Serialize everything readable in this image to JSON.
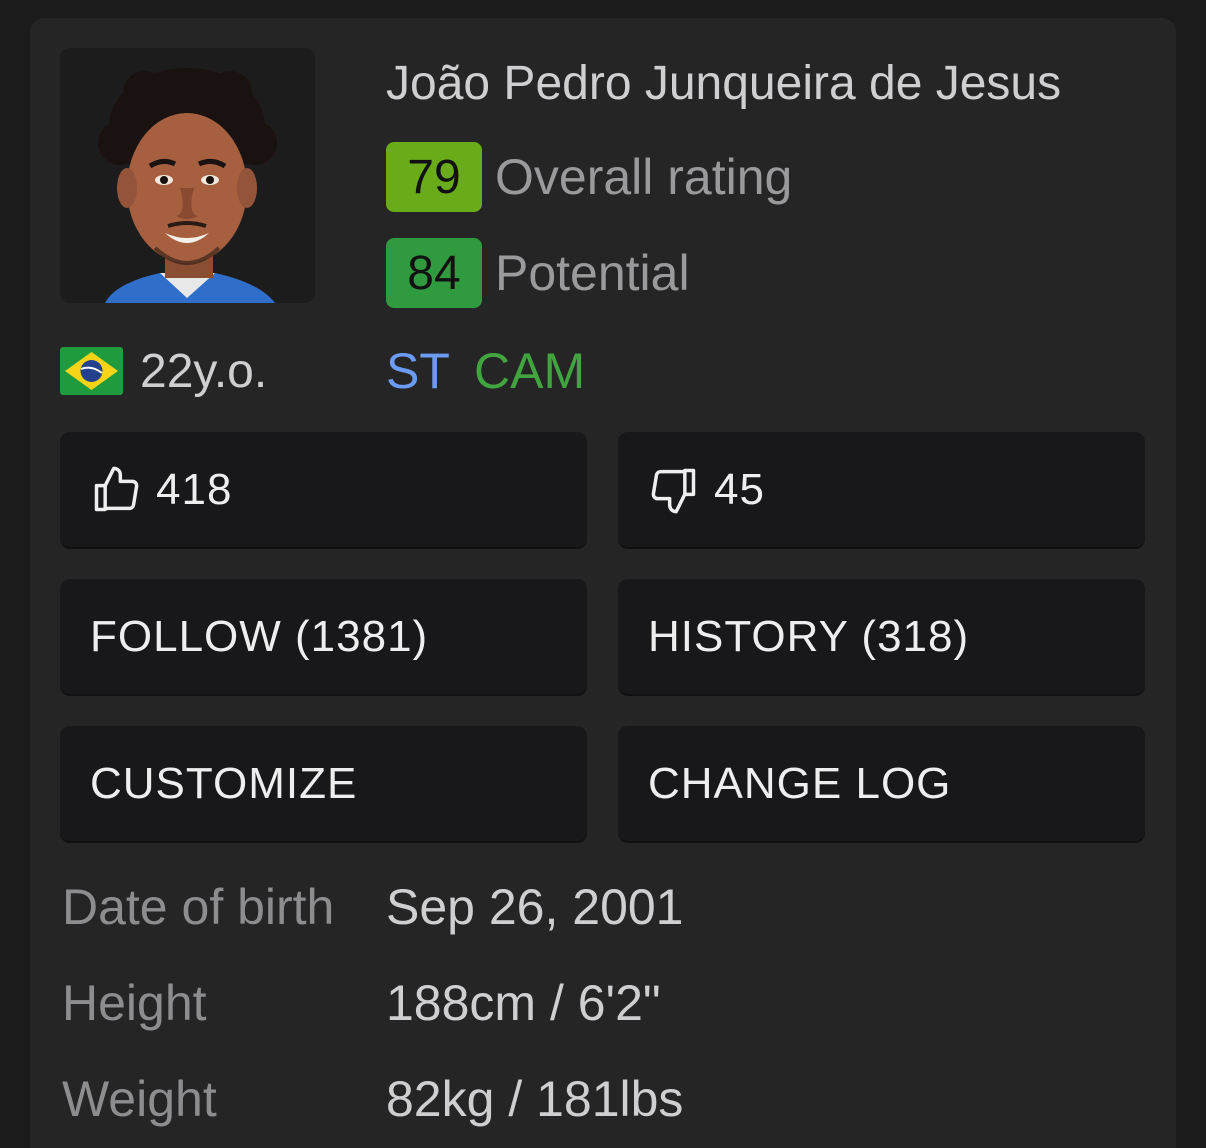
{
  "player": {
    "name": "João Pedro Junqueira de Jesus",
    "age": "22y.o.",
    "nationality_flag_icon": "brazil-flag-icon"
  },
  "ratings": [
    {
      "value": "79",
      "label": "Overall rating",
      "color": "#6aab1a"
    },
    {
      "value": "84",
      "label": "Potential",
      "color": "#2f9a3e"
    }
  ],
  "positions": [
    {
      "label": "ST",
      "color": "#6b9bf2"
    },
    {
      "label": "CAM",
      "color": "#41a43f"
    }
  ],
  "actions": {
    "likes": "418",
    "dislikes": "45",
    "like_icon": "thumbs-up-icon",
    "dislike_icon": "thumbs-down-icon",
    "follow": "FOLLOW (1381)",
    "history": "HISTORY (318)",
    "customize": "CUSTOMIZE",
    "change_log": "CHANGE LOG"
  },
  "info": [
    {
      "label": "Date of birth",
      "value": "Sep 26, 2001"
    },
    {
      "label": "Height",
      "value": "188cm / 6'2\""
    },
    {
      "label": "Weight",
      "value": "82kg / 181lbs"
    }
  ]
}
